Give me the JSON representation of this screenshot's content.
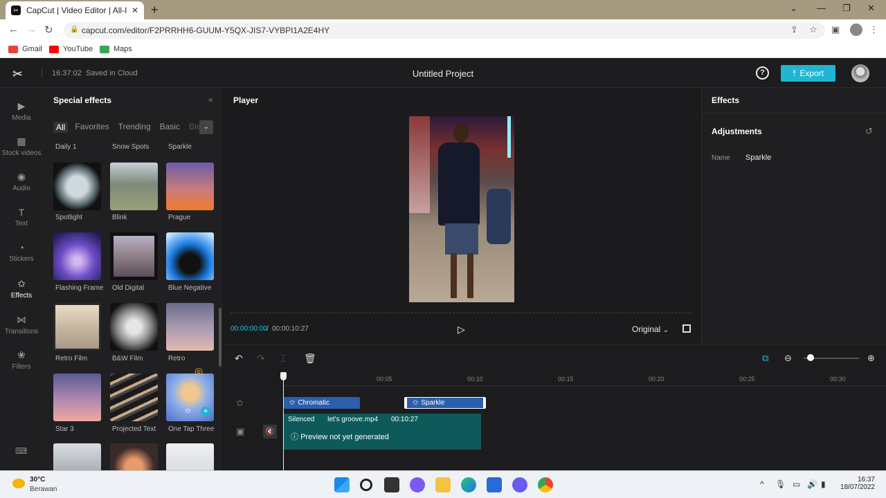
{
  "browser": {
    "tab_title": "CapCut | Video Editor | All-In-One",
    "url": "capcut.com/editor/F2PRRHH6-GUUM-Y5QX-JIS7-VYBPI1A2E4HY",
    "bookmarks": [
      "Gmail",
      "YouTube",
      "Maps"
    ]
  },
  "header": {
    "time": "16:37:02",
    "saved": "Saved in Cloud",
    "project_title": "Untitled Project",
    "help": "?",
    "export_label": "Export"
  },
  "rail": [
    "Media",
    "Stock videos",
    "Audio",
    "Text",
    "Stickers",
    "Effects",
    "Transitions",
    "Filters"
  ],
  "effects_panel": {
    "title": "Special effects",
    "filter_tabs": [
      "All",
      "Favorites",
      "Trending",
      "Basic",
      "Ble"
    ],
    "row0_labels": [
      "Daily 1",
      "Snow Spots",
      "Sparkle"
    ],
    "items": [
      "Spotlight",
      "Blink",
      "Prague",
      "Flashing Frame",
      "Old Digital",
      "Blue Negative",
      "Retro Film",
      "B&W Film",
      "Retro",
      "Star 3",
      "Projected Text",
      "One Tap Three"
    ]
  },
  "player": {
    "title": "Player",
    "current_time": "00:00:00:00",
    "separator": "/",
    "total_time": "00:00:10:27",
    "ratio_label": "Original"
  },
  "right_panel": {
    "title": "Effects",
    "section": "Adjustments",
    "name_label": "Name",
    "name_value": "Sparkle"
  },
  "timeline": {
    "ticks": [
      "00:05",
      "00:10",
      "00:15",
      "00:20",
      "00:25",
      "00:30"
    ],
    "fx_clip_1": "Chromatic",
    "fx_clip_2": "Sparkle",
    "video_clip": {
      "status": "Silenced",
      "file": "let's groove.mp4",
      "duration": "00:10:27",
      "preview": "Preview not yet generated"
    }
  },
  "taskbar": {
    "temp": "30°C",
    "weather": "Berawan",
    "time": "16:37",
    "date": "18/07/2022"
  }
}
